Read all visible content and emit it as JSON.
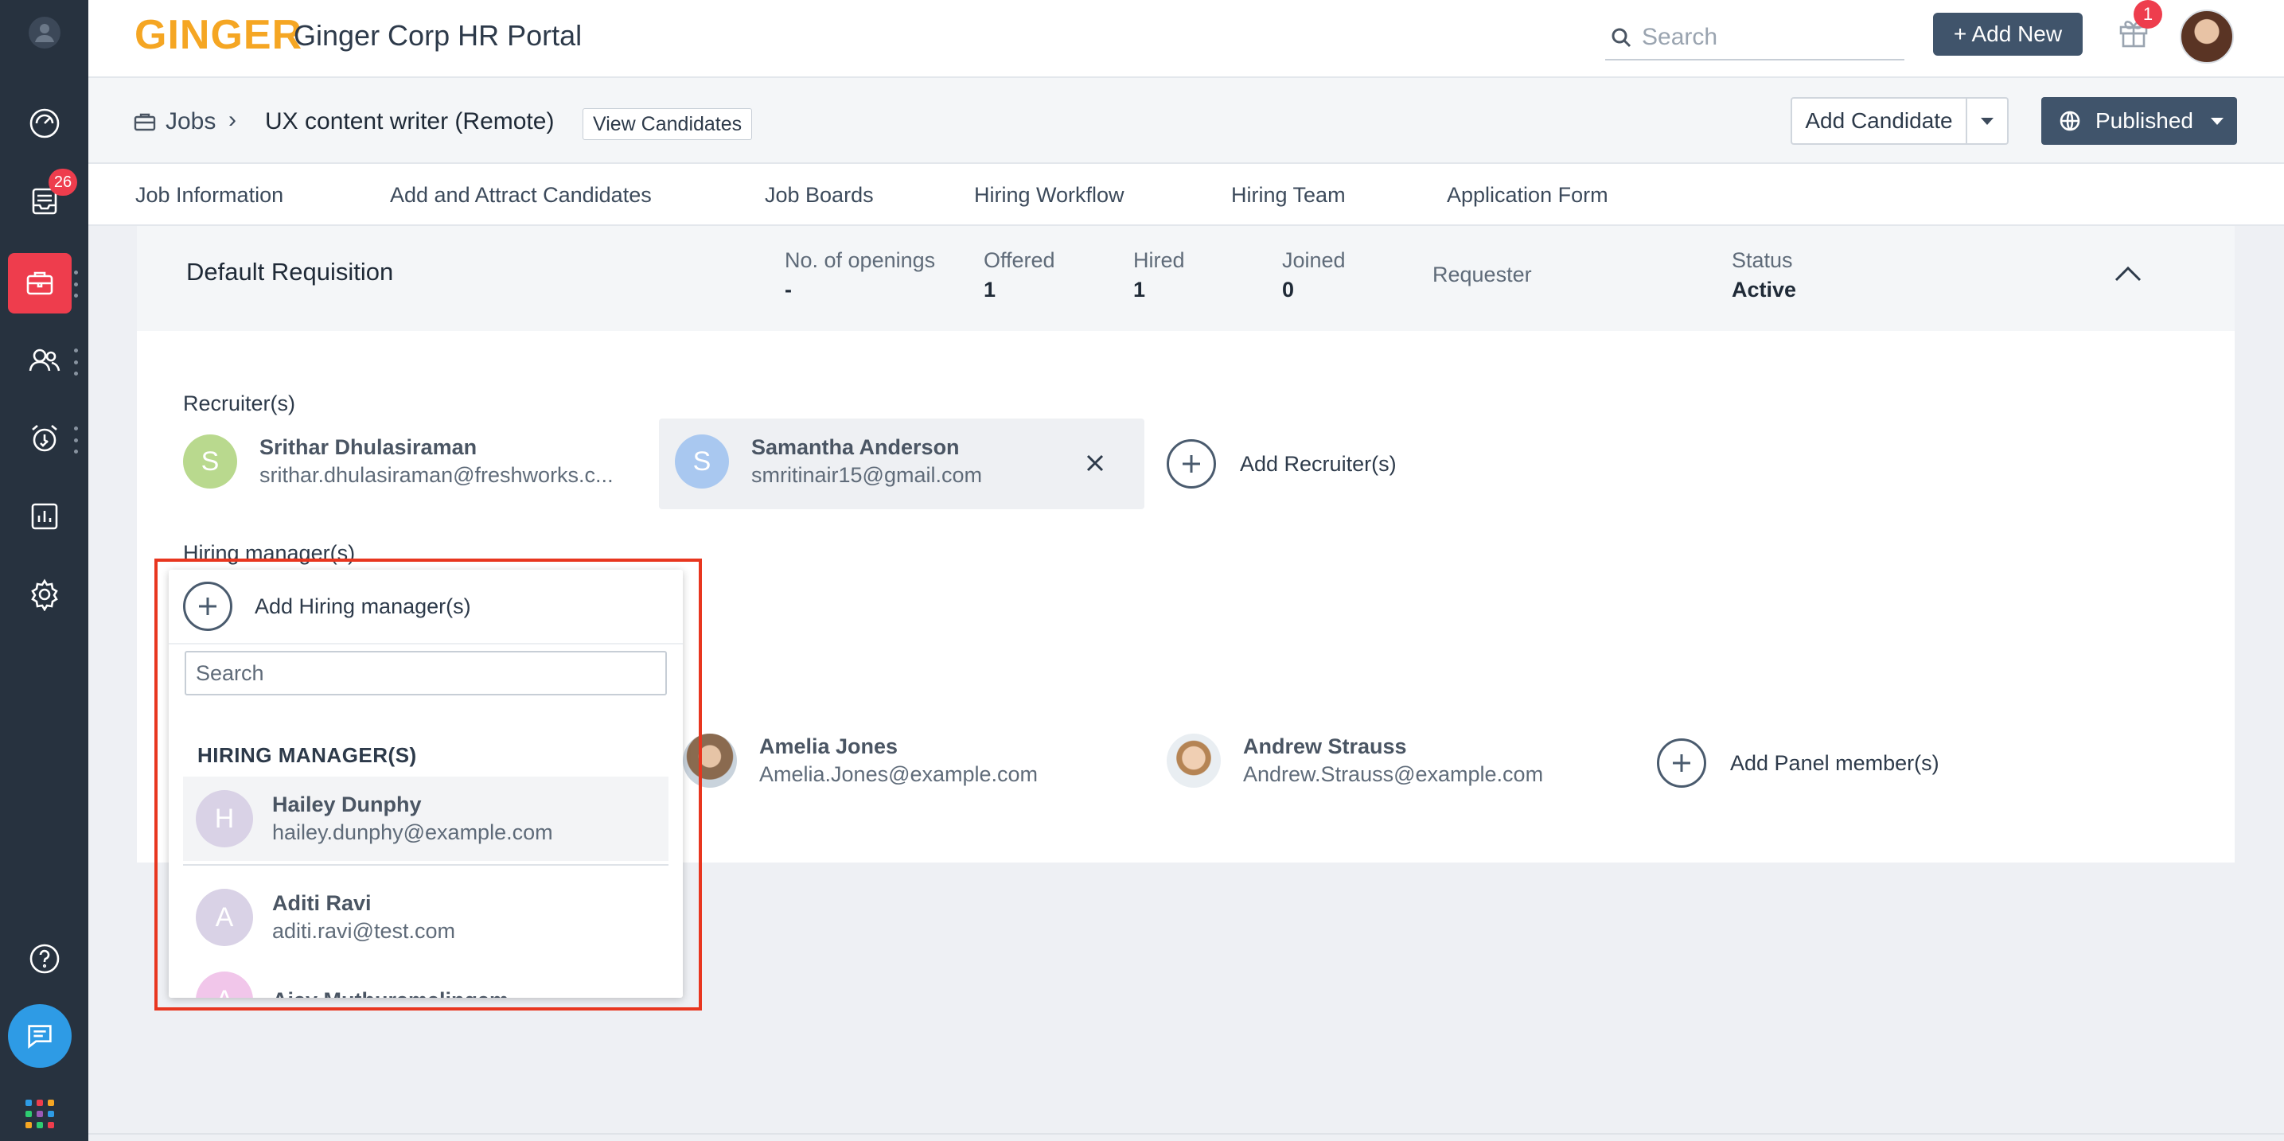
{
  "sidebar": {
    "inbox_badge": "26",
    "icons": [
      "profile-icon",
      "dashboard-icon",
      "inbox-icon",
      "jobs-icon",
      "candidates-icon",
      "alarm-icon",
      "reports-icon",
      "settings-icon",
      "help-icon",
      "chat-icon",
      "apps-grid-icon"
    ],
    "active_color": "#ee3d4d"
  },
  "header": {
    "logo": "GINGER",
    "title": "Ginger Corp HR Portal",
    "search_placeholder": "Search",
    "add_new": "+ Add New",
    "gift_badge": "1"
  },
  "breadcrumb": {
    "jobs": "Jobs",
    "separator": "›",
    "job_title": "UX content writer (Remote)",
    "view_candidates": "View Candidates",
    "add_candidate": "Add Candidate",
    "published": "Published"
  },
  "tabs": [
    "Job Information",
    "Add and Attract Candidates",
    "Job Boards",
    "Hiring Workflow",
    "Hiring Team",
    "Application Form"
  ],
  "requisition": {
    "title": "Default Requisition",
    "metrics": [
      {
        "label": "No. of openings",
        "value": "-"
      },
      {
        "label": "Offered",
        "value": "1"
      },
      {
        "label": "Hired",
        "value": "1"
      },
      {
        "label": "Joined",
        "value": "0"
      },
      {
        "label": "Requester",
        "value": ""
      },
      {
        "label": "Status",
        "value": "Active"
      }
    ]
  },
  "recruiters": {
    "label": "Recruiter(s)",
    "people": [
      {
        "initial": "S",
        "name": "Srithar Dhulasiraman",
        "email": "srithar.dhulasiraman@freshworks.c...",
        "color": "#b9d98e"
      },
      {
        "initial": "S",
        "name": "Samantha Anderson",
        "email": "smritinair15@gmail.com",
        "color": "#a9c8f0"
      }
    ],
    "add_label": "Add Recruiter(s)"
  },
  "hiring_managers": {
    "label": "Hiring manager(s)"
  },
  "panel": {
    "people": [
      {
        "name": "Amelia Jones",
        "email": "Amelia.Jones@example.com"
      },
      {
        "name": "Andrew Strauss",
        "email": "Andrew.Strauss@example.com"
      }
    ],
    "add_label": "Add Panel member(s)"
  },
  "dropdown": {
    "add_label": "Add Hiring manager(s)",
    "search_placeholder": "Search",
    "group": "HIRING MANAGER(S)",
    "items": [
      {
        "initial": "H",
        "name": "Hailey Dunphy",
        "email": "hailey.dunphy@example.com",
        "color": "#d9d2e6"
      },
      {
        "initial": "A",
        "name": "Aditi Ravi",
        "email": "aditi.ravi@test.com",
        "color": "#d9d2e6"
      },
      {
        "initial": "A",
        "name": "Ajay Muthuramalingam",
        "email": "",
        "color": "#f1c6ea"
      }
    ]
  }
}
